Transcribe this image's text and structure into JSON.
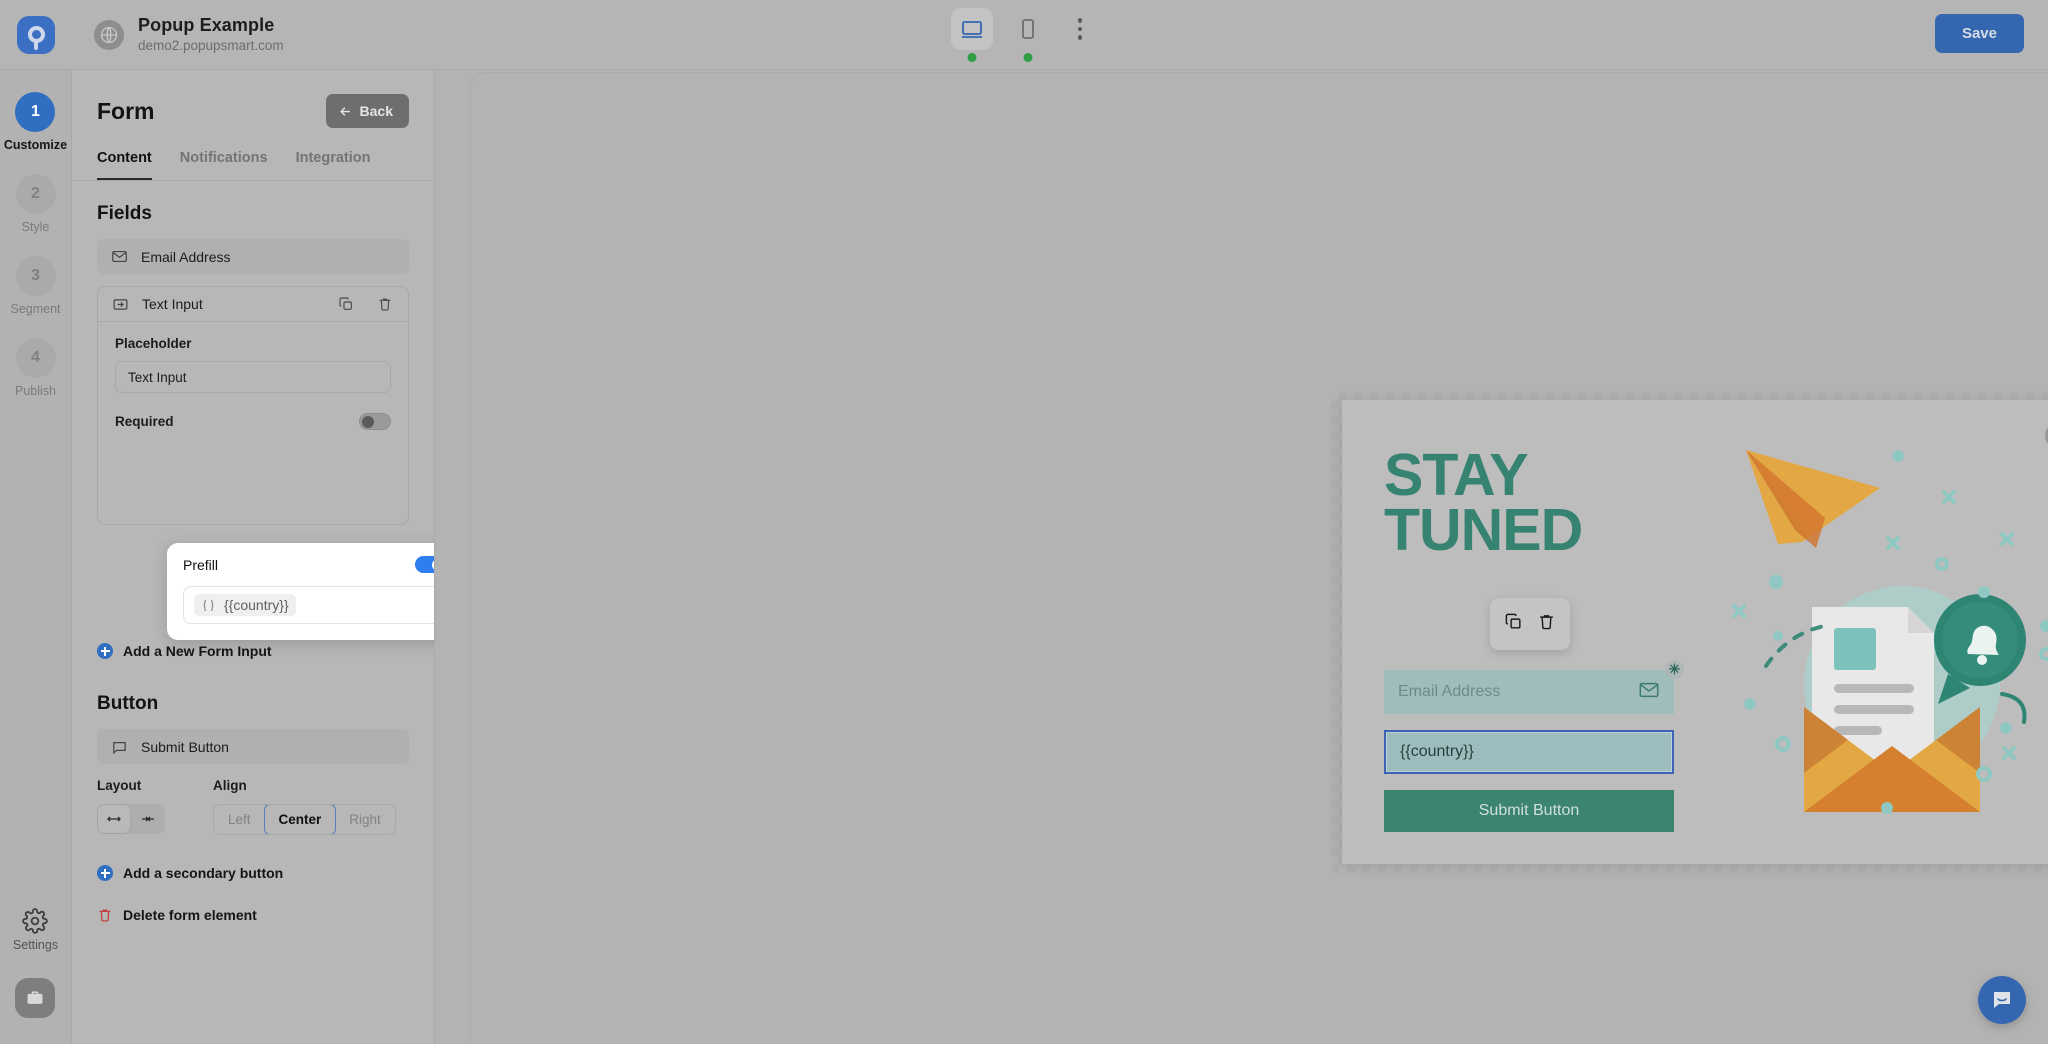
{
  "header": {
    "logo_icon": "popupsmart-logo-icon",
    "globe_icon": "globe-icon",
    "site_title": "Popup Example",
    "site_url": "demo2.popupsmart.com",
    "devices": [
      {
        "icon": "desktop-icon",
        "name": "desktop",
        "active": true,
        "status_dot": "green"
      },
      {
        "icon": "mobile-icon",
        "name": "mobile",
        "active": false,
        "status_dot": "green"
      }
    ],
    "more_icon": "kebab-menu-icon",
    "save_label": "Save"
  },
  "rail": {
    "steps": [
      {
        "number": "1",
        "label": "Customize",
        "active": true
      },
      {
        "number": "2",
        "label": "Style",
        "active": false
      },
      {
        "number": "3",
        "label": "Segment",
        "active": false
      },
      {
        "number": "4",
        "label": "Publish",
        "active": false
      }
    ],
    "settings_label": "Settings",
    "settings_icon": "gear-icon",
    "workspace_icon": "briefcase-icon"
  },
  "panel": {
    "title": "Form",
    "back_label": "Back",
    "back_icon": "arrow-left-icon",
    "tabs": [
      {
        "label": "Content",
        "active": true
      },
      {
        "label": "Notifications",
        "active": false
      },
      {
        "label": "Integration",
        "active": false
      }
    ],
    "fields_heading": "Fields",
    "email_field": {
      "icon": "envelope-icon",
      "label": "Email Address"
    },
    "text_field": {
      "icon": "text-input-icon",
      "label": "Text Input",
      "duplicate_icon": "copy-icon",
      "delete_icon": "trash-icon",
      "placeholder_label": "Placeholder",
      "placeholder_value": "Text Input",
      "placeholder_hint": "Text Input",
      "required_label": "Required",
      "required_on": false
    },
    "prefill": {
      "label": "Prefill",
      "enabled": true,
      "merge_icon": "code-braces-icon",
      "merge_value": "{{country}}"
    },
    "add_input_label": "Add a New Form Input",
    "button_heading": "Button",
    "submit_item": {
      "icon": "button-icon",
      "label": "Submit Button"
    },
    "layout_label": "Layout",
    "layout_options": [
      {
        "icon": "full-width-icon",
        "selected": true
      },
      {
        "icon": "fit-content-icon",
        "selected": false
      }
    ],
    "align_label": "Align",
    "align_options": [
      {
        "label": "Left",
        "selected": false
      },
      {
        "label": "Center",
        "selected": true
      },
      {
        "label": "Right",
        "selected": false
      }
    ],
    "add_secondary_label": "Add a secondary button",
    "delete_element_label": "Delete form element",
    "delete_icon": "trash-icon"
  },
  "canvas": {
    "popup": {
      "close_icon": "close-x-icon",
      "headline_line1": "STAY",
      "headline_line2": "TUNED",
      "email_placeholder": "Email Address",
      "email_icon": "envelope-icon",
      "required_marker": "✳",
      "country_value": "{{country}}",
      "submit_label": "Submit Button",
      "accent_color": "#368371",
      "field_bg": "#9fbdbb",
      "selection_color": "#3f62b5"
    },
    "float_toolbar": {
      "duplicate_icon": "copy-icon",
      "delete_icon": "trash-icon"
    },
    "illustration": {
      "name": "newsletter-envelope-illustration",
      "paper_plane_color": "#e0a03c",
      "envelope_color": "#dd9a3c",
      "bell_bubble_color": "#2f8573"
    }
  },
  "chat": {
    "icon": "chat-bubble-icon"
  }
}
